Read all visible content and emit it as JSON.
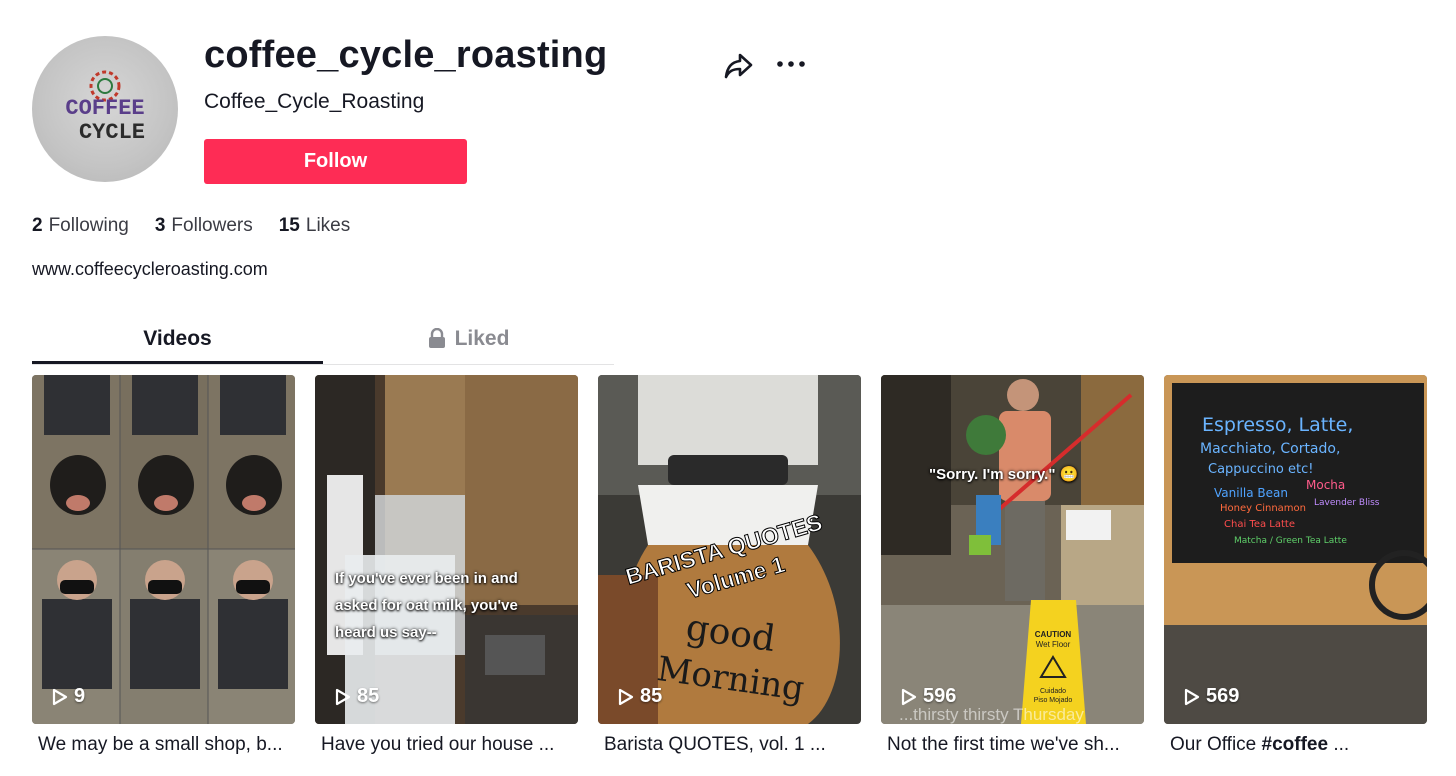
{
  "profile": {
    "username": "coffee_cycle_roasting",
    "display_name": "Coffee_Cycle_Roasting",
    "avatar_text_line1": "COFFEE",
    "avatar_text_line2": "CYCLE",
    "follow_label": "Follow",
    "share_icon": "share-arrow-icon",
    "more_icon": "more-horizontal-icon",
    "bio_link": "www.coffeecycleroasting.com"
  },
  "stats": [
    {
      "value": "2",
      "label": "Following"
    },
    {
      "value": "3",
      "label": "Followers"
    },
    {
      "value": "15",
      "label": "Likes"
    }
  ],
  "tabs": {
    "videos_label": "Videos",
    "liked_label": "Liked",
    "liked_icon": "lock-icon"
  },
  "videos": [
    {
      "views": "9",
      "caption": "We may be a small shop, b...",
      "overlay": ""
    },
    {
      "views": "85",
      "caption": "Have you tried our house ...",
      "overlay": "If you've ever been in and asked for oat milk, you've heard us say--",
      "overlay_line1": "If you've ever been in and",
      "overlay_line2": "asked for oat milk, you've",
      "overlay_line3": "heard us say--"
    },
    {
      "views": "85",
      "caption": "Barista QUOTES, vol. 1 ...",
      "overlay_line1": "BARISTA QUOTES",
      "overlay_line2": "Volume 1",
      "mug_text1": "good",
      "mug_text2": "Morning"
    },
    {
      "views": "596",
      "caption": "Not the first time we've sh...",
      "overlay_line1": "\"Sorry. I'm sorry.\" 😬",
      "bottom_text": "...thirsty thirsty Thursday",
      "sign_text1": "CAUTION",
      "sign_text2": "Wet Floor",
      "sign_text3": "Cuidado",
      "sign_text4": "Piso Mojado"
    },
    {
      "views": "569",
      "caption_prefix": "Our Office ",
      "caption_tag": "#coffee",
      "caption_suffix": " ...",
      "board_line1": "Espresso, Latte,",
      "board_line2": "Macchiato, Cortado,",
      "board_line3": "Cappuccino etc!",
      "board_line4": "Vanilla Bean",
      "board_line5": "Mocha",
      "board_line6": "Honey Cinnamon",
      "board_line7": "Lavender Bliss",
      "board_line8": "Chai Tea Latte",
      "board_line9": "Matcha / Green Tea Latte"
    }
  ],
  "colors": {
    "accent": "#fe2c55",
    "text": "#161823",
    "muted": "#8a8b91"
  }
}
